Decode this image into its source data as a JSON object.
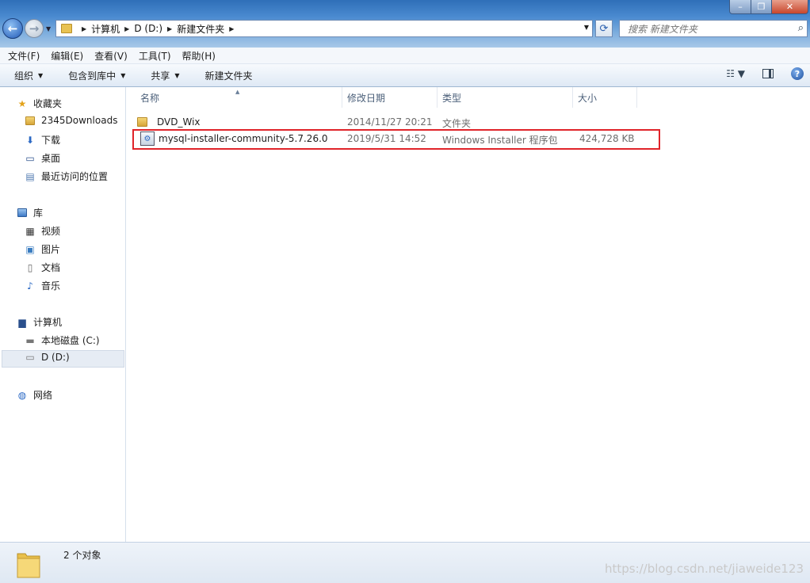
{
  "window": {
    "min_glyph": "–",
    "max_glyph": "❐",
    "close_glyph": "✕"
  },
  "navigation": {
    "back_glyph": "←",
    "forward_glyph": "→"
  },
  "address": {
    "breadcrumbs": [
      "计算机",
      "D (D:)",
      "新建文件夹"
    ]
  },
  "search": {
    "placeholder": "搜索 新建文件夹"
  },
  "menu": {
    "items": [
      "文件(F)",
      "编辑(E)",
      "查看(V)",
      "工具(T)",
      "帮助(H)"
    ]
  },
  "toolbar": {
    "organize": "组织",
    "include_in_library": "包含到库中",
    "share": "共享",
    "new_folder": "新建文件夹",
    "help": "?"
  },
  "sidebar": {
    "favorites": {
      "label": "收藏夹",
      "items": [
        "2345Downloads",
        "下载",
        "桌面",
        "最近访问的位置"
      ]
    },
    "libraries": {
      "label": "库",
      "items": [
        "视频",
        "图片",
        "文档",
        "音乐"
      ]
    },
    "computer": {
      "label": "计算机",
      "items": [
        "本地磁盘 (C:)",
        "D (D:)"
      ],
      "selected": "D (D:)"
    },
    "network": {
      "label": "网络"
    }
  },
  "columns": {
    "name": "名称",
    "date": "修改日期",
    "type": "类型",
    "size": "大小"
  },
  "files": [
    {
      "name": "DVD_Wix",
      "date": "2014/11/27 20:21",
      "type": "文件夹",
      "size": ""
    },
    {
      "name": "mysql-installer-community-5.7.26.0",
      "date": "2019/5/31 14:52",
      "type": "Windows Installer 程序包",
      "size": "424,728 KB"
    }
  ],
  "status": {
    "count": "2 个对象"
  },
  "watermark": "https://blog.csdn.net/jiaweide123",
  "colors": {
    "highlight_border": "#e0242a",
    "titlebar": "#4a8ad0"
  }
}
